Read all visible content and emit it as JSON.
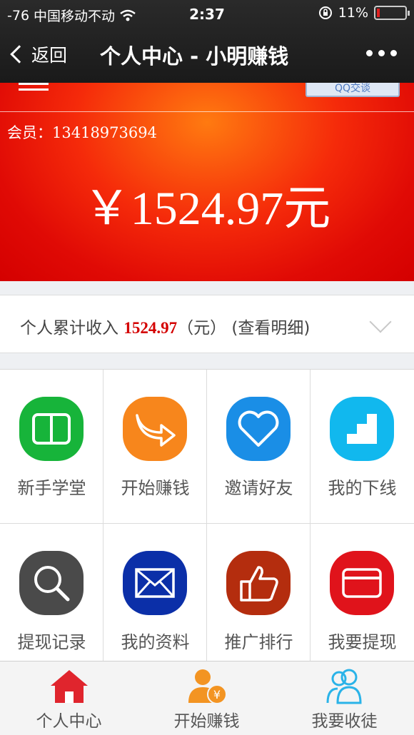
{
  "status_bar": {
    "signal": "-76",
    "carrier": "中国移动不动",
    "time": "2:37",
    "battery": "11%",
    "battery_level": 0.11
  },
  "nav": {
    "back_label": "返回",
    "title": "个人中心 - 小明赚钱"
  },
  "banner": {
    "qq_label": "QQ交谈",
    "member_label": "会员：",
    "member_id": "13418973694",
    "amount": "￥1524.97元"
  },
  "income": {
    "prefix": "个人累计收入 ",
    "value": "1524.97",
    "unit": "（元）",
    "detail": "(查看明细)"
  },
  "grid": [
    {
      "label": "新手学堂",
      "icon": "book-icon",
      "color": "#17b43a"
    },
    {
      "label": "开始赚钱",
      "icon": "forward-arrow-icon",
      "color": "#f7861c"
    },
    {
      "label": "邀请好友",
      "icon": "heart-icon",
      "color": "#1a8ee6"
    },
    {
      "label": "我的下线",
      "icon": "stairs-icon",
      "color": "#11b8ee"
    },
    {
      "label": "提现记录",
      "icon": "magnifier-icon",
      "color": "#4a4a4a"
    },
    {
      "label": "我的资料",
      "icon": "envelope-icon",
      "color": "#0b2fa8"
    },
    {
      "label": "推广排行",
      "icon": "thumbs-up-icon",
      "color": "#b42d0e"
    },
    {
      "label": "我要提现",
      "icon": "card-icon",
      "color": "#e0131b"
    }
  ],
  "tabbar": [
    {
      "label": "个人中心",
      "icon": "home-icon",
      "color": "#e0252d"
    },
    {
      "label": "开始赚钱",
      "icon": "user-yuan-icon",
      "color": "#f39422"
    },
    {
      "label": "我要收徒",
      "icon": "users-icon",
      "color": "#2ab3e8"
    }
  ]
}
